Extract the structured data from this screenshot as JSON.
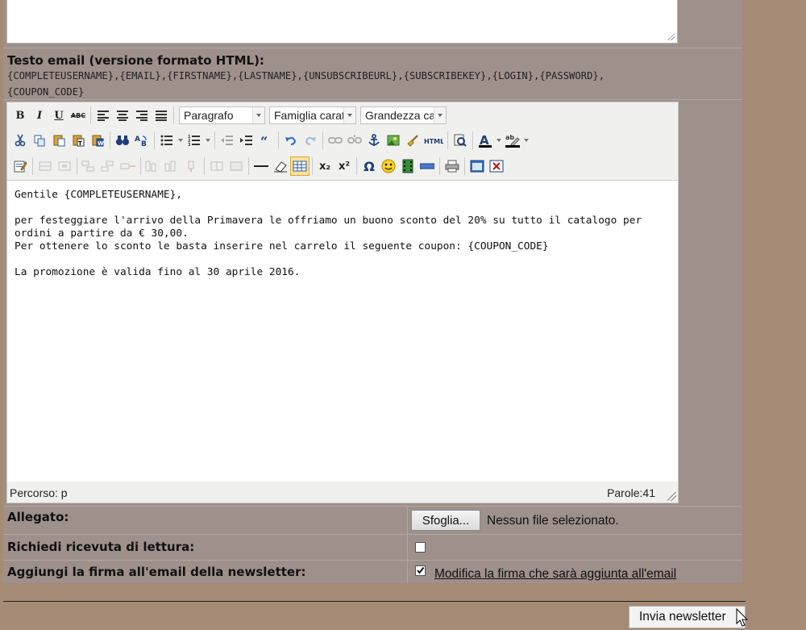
{
  "html_section": {
    "label": "Testo email (versione formato HTML):",
    "placeholders_line1": "{COMPLETEUSERNAME},{EMAIL},{FIRSTNAME},{LASTNAME},{UNSUBSCRIBEURL},{SUBSCRIBEKEY},{LOGIN},{PASSWORD},",
    "placeholders_line2": "{COUPON_CODE}"
  },
  "toolbar": {
    "bold": "B",
    "italic": "I",
    "underline": "U",
    "strike": "ABC",
    "format_select": "Paragrafo",
    "font_family_select": "Famiglia caratt",
    "font_size_select": "Grandezza car",
    "html_button": "HTML",
    "subscript": "x₂",
    "superscript": "x²",
    "omega": "Ω"
  },
  "content": {
    "greeting": "Gentile {COMPLETEUSERNAME},",
    "para1": "per festeggiare l'arrivo della Primavera le offriamo un buono sconto del 20% su tutto il catalogo per ordini a partire da € 30,00.",
    "para1_line2": "Per ottenere lo sconto le basta inserire nel carrelo il seguente coupon: {COUPON_CODE}",
    "para2": "La promozione è valida fino al 30 aprile 2016."
  },
  "statusbar": {
    "path": "Percorso: p",
    "words": "Parole:41"
  },
  "attachment": {
    "label": "Allegato:",
    "browse_button": "Sfoglia...",
    "file_status": "Nessun file selezionato."
  },
  "read_receipt": {
    "label": "Richiedi ricevuta di lettura:",
    "checked": false
  },
  "signature": {
    "label": "Aggiungi la firma all'email della newsletter:",
    "checked": true,
    "link": "Modifica la firma che sarà aggiunta all'email"
  },
  "send_button": "Invia newsletter",
  "colors": {
    "page_bg": "#a58a75",
    "panel_bg": "#9e908a",
    "toolbar_bg": "#f0f0ee",
    "active_button": "#fbe29a"
  }
}
